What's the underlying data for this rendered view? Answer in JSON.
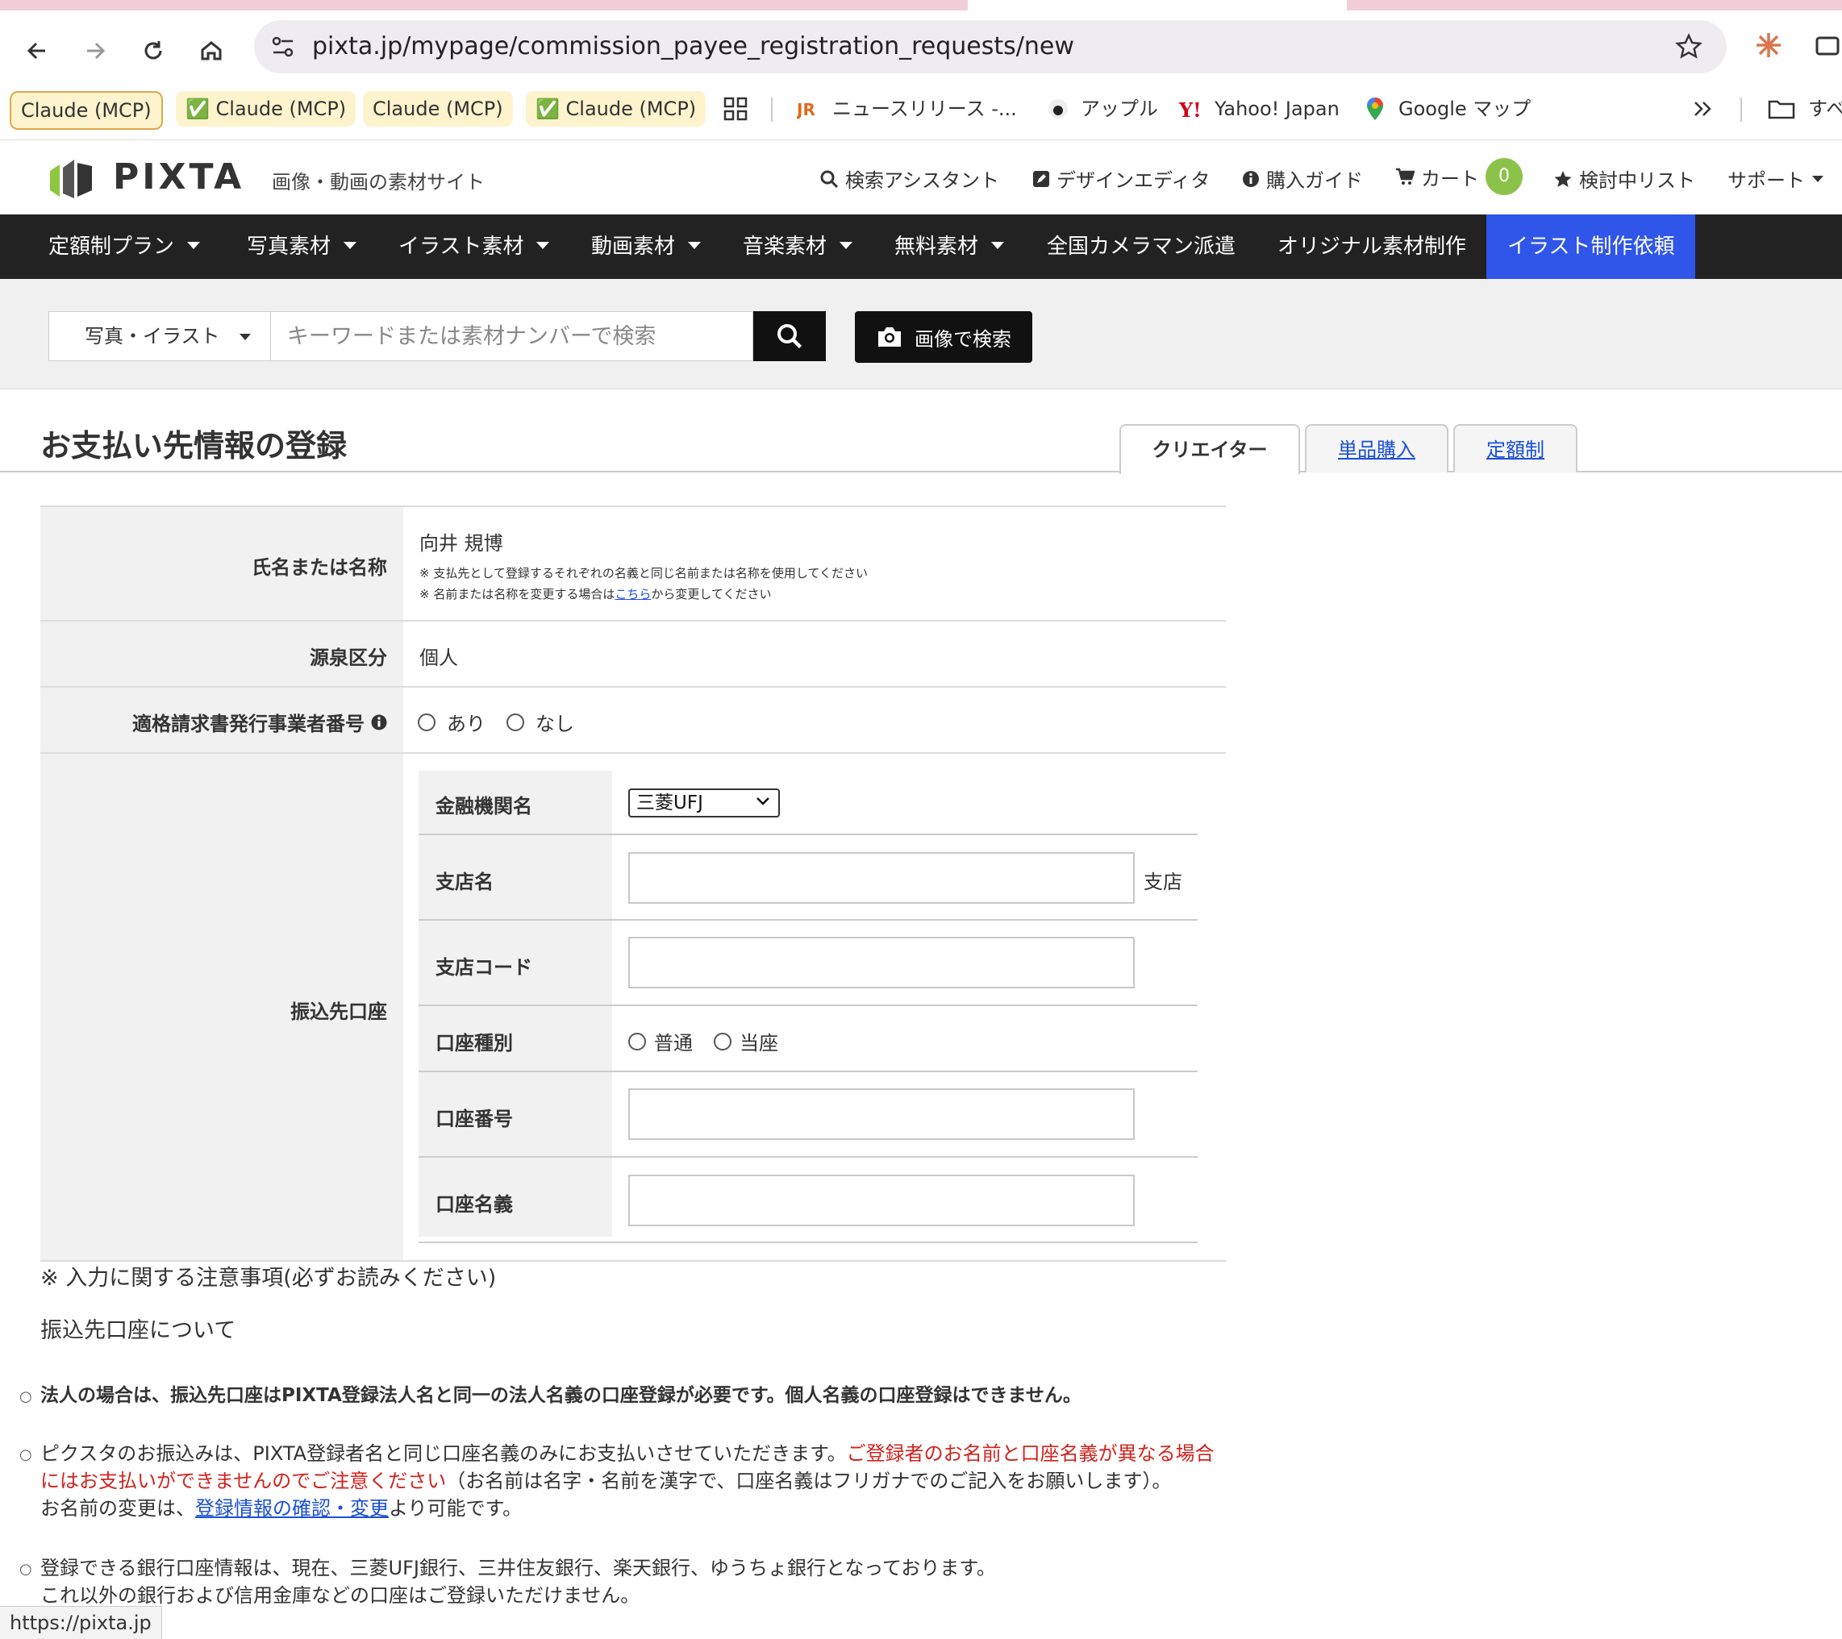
{
  "browser": {
    "url": "pixta.jp/mypage/commission_payee_registration_requests/new",
    "bookmarks": [
      {
        "label": "Claude (MCP)"
      },
      {
        "label": "✅ Claude (MCP)"
      },
      {
        "label": "Claude (MCP)"
      },
      {
        "label": "✅ Claude (MCP)"
      },
      {
        "label": "ニュースリリース -..."
      },
      {
        "label": "アップル"
      },
      {
        "label": "Yahoo! Japan"
      },
      {
        "label": "Google マップ"
      },
      {
        "label": "すべ"
      }
    ],
    "status_link": "https://pixta.jp"
  },
  "header": {
    "logo": "PIXTA",
    "tagline": "画像・動画の素材サイト",
    "links": {
      "search_assistant": "検索アシスタント",
      "design_editor": "デザインエディタ",
      "purchase_guide": "購入ガイド",
      "cart": "カート",
      "cart_count": "0",
      "watchlist": "検討中リスト",
      "support": "サポート"
    }
  },
  "nav": {
    "items": [
      {
        "label": "定額制プラン"
      },
      {
        "label": "写真素材"
      },
      {
        "label": "イラスト素材"
      },
      {
        "label": "動画素材"
      },
      {
        "label": "音楽素材"
      },
      {
        "label": "無料素材"
      },
      {
        "label": "全国カメラマン派遣"
      },
      {
        "label": "オリジナル素材制作"
      },
      {
        "label": "イラスト制作依頼"
      }
    ]
  },
  "search": {
    "type_label": "写真・イラスト",
    "placeholder": "キーワードまたは素材ナンバーで検索",
    "image_search_label": "画像で検索"
  },
  "page": {
    "title": "お支払い先情報の登録",
    "tabs": [
      {
        "label": "クリエイター"
      },
      {
        "label": "単品購入"
      },
      {
        "label": "定額制"
      }
    ]
  },
  "form": {
    "name": {
      "label": "氏名または名称",
      "value": "向井 規博",
      "note1": "※ 支払先として登録するそれぞれの名義と同じ名前または名称を使用してください",
      "note2_prefix": "※ 名前または名称を変更する場合は",
      "note2_link": "こちら",
      "note2_suffix": "から変更してください"
    },
    "withholding": {
      "label": "源泉区分",
      "value": "個人"
    },
    "invoice": {
      "label": "適格請求書発行事業者番号",
      "option_yes": "あり",
      "option_no": "なし"
    },
    "account": {
      "label": "振込先口座",
      "bank_label": "金融機関名",
      "bank_value": "三菱UFJ",
      "branch_label": "支店名",
      "branch_suffix": "支店",
      "branch_code_label": "支店コード",
      "type_label": "口座種別",
      "type_ordinary": "普通",
      "type_current": "当座",
      "number_label": "口座番号",
      "holder_label": "口座名義"
    }
  },
  "notes": {
    "heading": "※ 入力に関する注意事項(必ずお読みください)",
    "section": "振込先口座について",
    "corp": "法人の場合は、振込先口座はPIXTA登録法人名と同一の法人名義の口座登録が必要です。個人名義の口座登録はできません。",
    "p2_a": "ピクスタのお振込みは、PIXTA登録者名と同じ口座名義のみにお支払いさせていただきます。",
    "p2_red1": "ご登録者のお名前と口座名義が異なる場合",
    "p2_red2": "にはお支払いができませんのでご注意ください",
    "p2_b": "（お名前は名字・名前を漢字で、口座名義はフリガナでのご記入をお願いします）。",
    "p3_prefix": "お名前の変更は、",
    "p3_link": "登録情報の確認・変更",
    "p3_suffix": "より可能です。",
    "p4_line1": "登録できる銀行口座情報は、現在、三菱UFJ銀行、三井住友銀行、楽天銀行、ゆうちょ銀行となっております。",
    "p4_line2": "これ以外の銀行および信用金庫などの口座はご登録いただけません。"
  }
}
